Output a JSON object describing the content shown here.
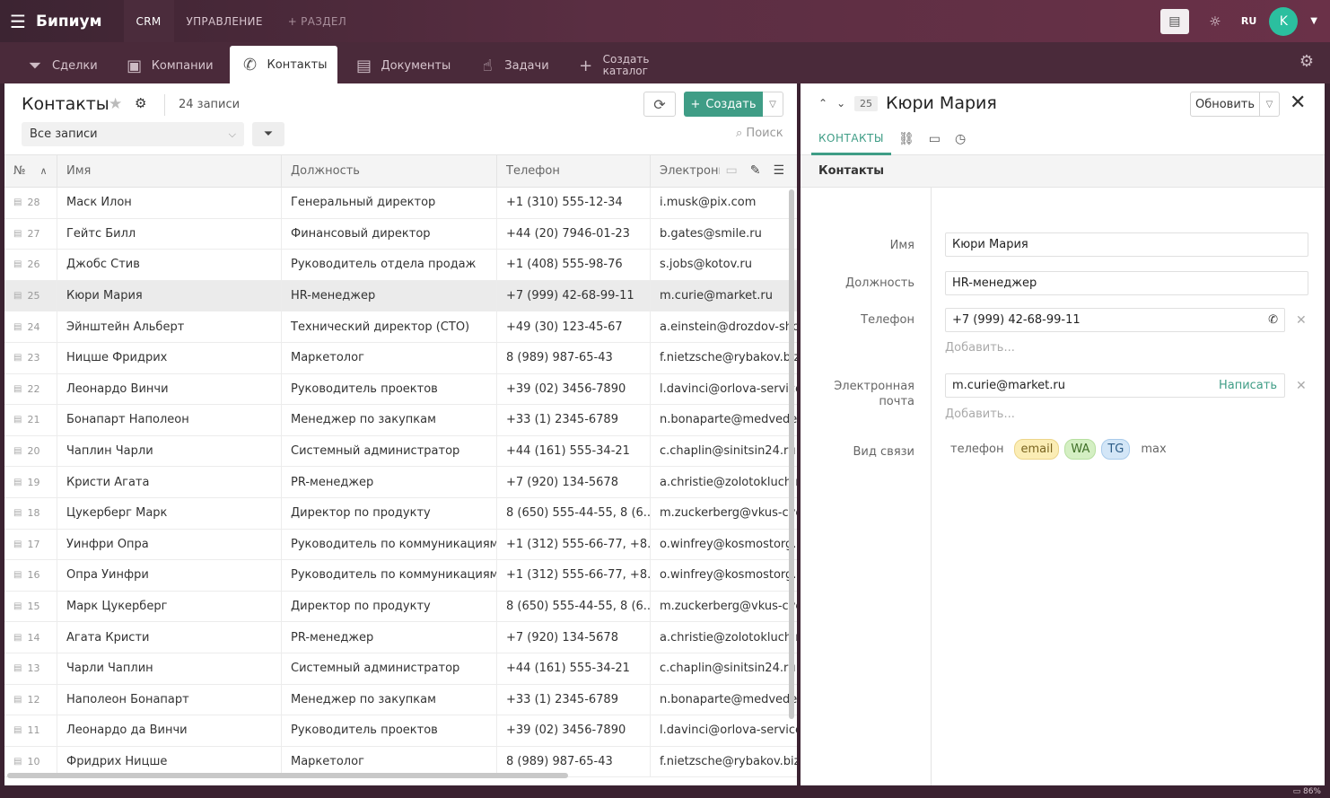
{
  "app": {
    "logo": "Бипиум"
  },
  "topnav": [
    {
      "label": "CRM",
      "active": true
    },
    {
      "label": "УПРАВЛЕНИЕ",
      "active": false
    },
    {
      "label": "+ РАЗДЕЛ",
      "active": false
    }
  ],
  "user": {
    "lang": "RU",
    "avatar_letter": "K"
  },
  "tabs": [
    {
      "label": "Сделки",
      "icon": "funnel-icon"
    },
    {
      "label": "Компании",
      "icon": "briefcase-icon"
    },
    {
      "label": "Контакты",
      "icon": "phone-icon",
      "active": true
    },
    {
      "label": "Документы",
      "icon": "documents-icon"
    },
    {
      "label": "Задачи",
      "icon": "tap-hand-icon"
    },
    {
      "label_line1": "Создать",
      "label_line2": "каталог",
      "icon": "plus-icon"
    }
  ],
  "list": {
    "title": "Контакты",
    "count": "24 записи",
    "create_label": "Создать",
    "filter_value": "Все записи",
    "search_placeholder": "Поиск",
    "columns": [
      "№",
      "Имя",
      "Должность",
      "Телефон",
      "Электронн"
    ],
    "rows": [
      {
        "id": "28",
        "name": "Маск Илон",
        "position": "Генеральный директор",
        "phone": "+1 (310) 555-12-34",
        "email": "i.musk@pix.com"
      },
      {
        "id": "27",
        "name": "Гейтс Билл",
        "position": "Финансовый директор",
        "phone": "+44 (20) 7946-01-23",
        "email": "b.gates@smile.ru"
      },
      {
        "id": "26",
        "name": "Джобс Стив",
        "position": "Руководитель отдела продаж",
        "phone": "+1 (408) 555-98-76",
        "email": "s.jobs@kotov.ru"
      },
      {
        "id": "25",
        "name": "Кюри Мария",
        "position": "HR-менеджер",
        "phone": "+7 (999) 42-68-99-11",
        "email": "m.curie@market.ru",
        "selected": true
      },
      {
        "id": "24",
        "name": "Эйнштейн Альберт",
        "position": "Технический директор (CTO)",
        "phone": "+49 (30) 123-45-67",
        "email": "a.einstein@drozdov-shop"
      },
      {
        "id": "23",
        "name": "Ницше Фридрих",
        "position": "Маркетолог",
        "phone": "8 (989) 987-65-43",
        "email": "f.nietzsche@rybakov.biz"
      },
      {
        "id": "22",
        "name": "Леонардо Винчи",
        "position": "Руководитель проектов",
        "phone": "+39 (02) 3456-7890",
        "email": "l.davinci@orlova-service."
      },
      {
        "id": "21",
        "name": "Бонапарт Наполеон",
        "position": "Менеджер по закупкам",
        "phone": "+33 (1) 2345-6789",
        "email": "n.bonaparte@medvedev"
      },
      {
        "id": "20",
        "name": "Чаплин Чарли",
        "position": "Системный администратор",
        "phone": "+44 (161) 555-34-21",
        "email": "c.chaplin@sinitsin24.ru"
      },
      {
        "id": "19",
        "name": "Кристи Агата",
        "position": "PR-менеджер",
        "phone": "+7 (920) 134-5678",
        "email": "a.christie@zolotokluch.ru"
      },
      {
        "id": "18",
        "name": "Цукерберг Марк",
        "position": "Директор по продукту",
        "phone": "8 (650) 555-44-55, 8 (6...",
        "email": "m.zuckerberg@vkus-cve"
      },
      {
        "id": "17",
        "name": "Уинфри Опра",
        "position": "Руководитель по коммуникациям",
        "phone": "+1 (312) 555-66-77, +8...",
        "email": "o.winfrey@kosmostorg.r"
      },
      {
        "id": "16",
        "name": "Опра Уинфри",
        "position": "Руководитель по коммуникациям",
        "phone": "+1 (312) 555-66-77, +8...",
        "email": "o.winfrey@kosmostorg.r"
      },
      {
        "id": "15",
        "name": "Марк Цукерберг",
        "position": "Директор по продукту",
        "phone": "8 (650) 555-44-55, 8 (6...",
        "email": "m.zuckerberg@vkus-cve"
      },
      {
        "id": "14",
        "name": "Агата Кристи",
        "position": "PR-менеджер",
        "phone": "+7 (920) 134-5678",
        "email": "a.christie@zolotokluch.ru"
      },
      {
        "id": "13",
        "name": "Чарли Чаплин",
        "position": "Системный администратор",
        "phone": "+44 (161) 555-34-21",
        "email": "c.chaplin@sinitsin24.ru"
      },
      {
        "id": "12",
        "name": "Наполеон Бонапарт",
        "position": "Менеджер по закупкам",
        "phone": "+33 (1) 2345-6789",
        "email": "n.bonaparte@medvedev"
      },
      {
        "id": "11",
        "name": "Леонардо да Винчи",
        "position": "Руководитель проектов",
        "phone": "+39 (02) 3456-7890",
        "email": "l.davinci@orlova-service."
      },
      {
        "id": "10",
        "name": "Фридрих Ницше",
        "position": "Маркетолог",
        "phone": "8 (989) 987-65-43",
        "email": "f.nietzsche@rybakov.biz"
      }
    ]
  },
  "detail": {
    "id": "25",
    "title": "Кюри Мария",
    "update_label": "Обновить",
    "tab_contacts": "КОНТАКТЫ",
    "section": "Контакты",
    "fields": {
      "name_label": "Имя",
      "name_value": "Кюри Мария",
      "position_label": "Должность",
      "position_value": "HR-менеджер",
      "phone_label": "Телефон",
      "phone_value": "+7 (999) 42-68-99-11",
      "email_label_1": "Электронная",
      "email_label_2": "почта",
      "email_value": "m.curie@market.ru",
      "write_label": "Написать",
      "add_label": "Добавить...",
      "channel_label": "Вид связи"
    },
    "channels": [
      "телефон",
      "email",
      "WA",
      "TG",
      "max"
    ]
  },
  "status": {
    "zoom": "86%"
  },
  "colors": {
    "accent": "#3f9d86",
    "topbar": "#5a2e42",
    "tabbar": "#4a2a3a"
  }
}
